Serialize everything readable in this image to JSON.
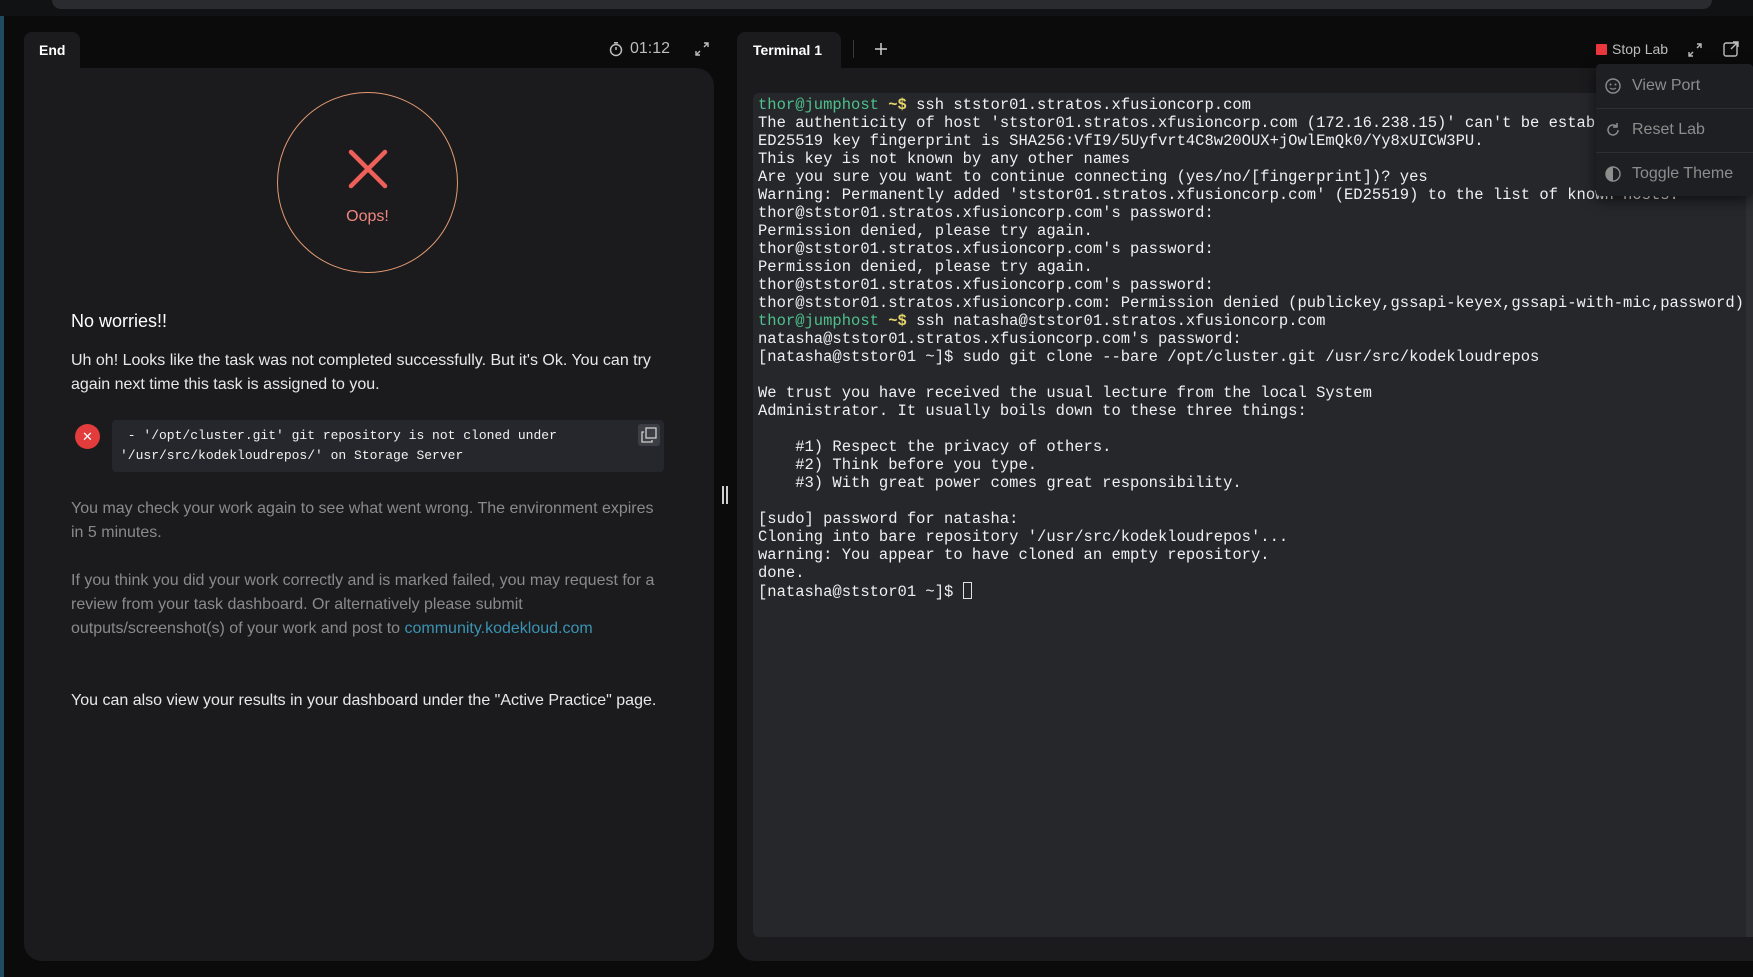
{
  "left": {
    "tab_label": "End",
    "timer": "01:12",
    "oops": "Oops!",
    "heading": "No worries!!",
    "description": "Uh oh! Looks like the task was not completed successfully. But it's Ok. You can try again next time this task is assigned to you.",
    "error_badge": "✕",
    "error_message": " - '/opt/cluster.git' git repository is not cloned under\n'/usr/src/kodekloudrepos/' on Storage Server",
    "check_again": "You may check your work again to see what went wrong. The environment expires in 5 minutes.",
    "review_text": "If you think you did your work correctly and is marked failed, you may request for a review from your task dashboard. Or alternatively please submit outputs/screenshot(s) of your work and post to ",
    "community_link": "community.kodekloud.com",
    "dashboard_text": "You can also view your results in your dashboard under the \"Active Practice\" page."
  },
  "right": {
    "tab_label": "Terminal 1",
    "stop_lab": "Stop Lab",
    "menu": {
      "view_port": "View Port",
      "reset_lab": "Reset Lab",
      "toggle_theme": "Toggle Theme"
    }
  },
  "terminal": {
    "lines": [
      {
        "user": "thor@jumphost",
        "path": " ~$",
        "text": " ssh ststor01.stratos.xfusioncorp.com"
      },
      {
        "text": "The authenticity of host 'ststor01.stratos.xfusioncorp.com (172.16.238.15)' can't be establis"
      },
      {
        "text": "ED25519 key fingerprint is SHA256:VfI9/5Uyfvrt4C8w20OUX+jOwlEmQk0/Yy8xUICW3PU."
      },
      {
        "text": "This key is not known by any other names"
      },
      {
        "text": "Are you sure you want to continue connecting (yes/no/[fingerprint])? yes"
      },
      {
        "text": "Warning: Permanently added 'ststor01.stratos.xfusioncorp.com' (ED25519) to the list of known hosts."
      },
      {
        "text": "thor@ststor01.stratos.xfusioncorp.com's password:"
      },
      {
        "text": "Permission denied, please try again."
      },
      {
        "text": "thor@ststor01.stratos.xfusioncorp.com's password:"
      },
      {
        "text": "Permission denied, please try again."
      },
      {
        "text": "thor@ststor01.stratos.xfusioncorp.com's password:"
      },
      {
        "text": "thor@ststor01.stratos.xfusioncorp.com: Permission denied (publickey,gssapi-keyex,gssapi-with-mic,password)."
      },
      {
        "user": "thor@jumphost",
        "path": " ~$",
        "text": " ssh natasha@ststor01.stratos.xfusioncorp.com"
      },
      {
        "text": "natasha@ststor01.stratos.xfusioncorp.com's password:"
      },
      {
        "text": "[natasha@ststor01 ~]$ sudo git clone --bare /opt/cluster.git /usr/src/kodekloudrepos"
      },
      {
        "text": ""
      },
      {
        "text": "We trust you have received the usual lecture from the local System"
      },
      {
        "text": "Administrator. It usually boils down to these three things:"
      },
      {
        "text": ""
      },
      {
        "text": "    #1) Respect the privacy of others."
      },
      {
        "text": "    #2) Think before you type."
      },
      {
        "text": "    #3) With great power comes great responsibility."
      },
      {
        "text": ""
      },
      {
        "text": "[sudo] password for natasha:"
      },
      {
        "text": "Cloning into bare repository '/usr/src/kodekloudrepos'..."
      },
      {
        "text": "warning: You appear to have cloned an empty repository."
      },
      {
        "text": "done."
      },
      {
        "text": "[natasha@ststor01 ~]$ ",
        "cursor": true
      }
    ]
  },
  "colors": {
    "accent_red": "#e8383d",
    "prompt_green": "#4fc08d",
    "prompt_yellow": "#e6d46a",
    "link_blue": "#3a93b3",
    "circle_orange": "#e49a72"
  }
}
